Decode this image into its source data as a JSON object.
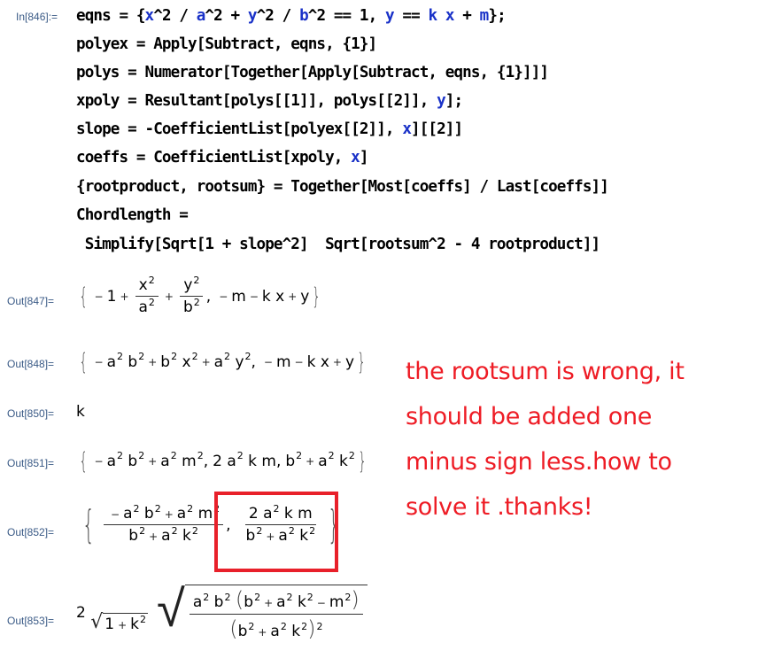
{
  "input": {
    "label": "In[846]:=",
    "lines": [
      {
        "parts": [
          {
            "t": "eqns = {"
          },
          {
            "t": "x",
            "v": 1
          },
          {
            "t": "^2 / "
          },
          {
            "t": "a",
            "v": 1
          },
          {
            "t": "^2 + "
          },
          {
            "t": "y",
            "v": 1
          },
          {
            "t": "^2 / "
          },
          {
            "t": "b",
            "v": 1
          },
          {
            "t": "^2 == 1, "
          },
          {
            "t": "y",
            "v": 1
          },
          {
            "t": " == "
          },
          {
            "t": "k",
            "v": 1
          },
          {
            "t": " "
          },
          {
            "t": "x",
            "v": 1
          },
          {
            "t": " + "
          },
          {
            "t": "m",
            "v": 1
          },
          {
            "t": "};"
          }
        ]
      },
      {
        "parts": [
          {
            "t": "polyex = Apply[Subtract, eqns, {1}]"
          }
        ]
      },
      {
        "parts": [
          {
            "t": "polys = Numerator[Together[Apply[Subtract, eqns, {1}]]]"
          }
        ]
      },
      {
        "parts": [
          {
            "t": "xpoly = Resultant[polys[[1]], polys[[2]], "
          },
          {
            "t": "y",
            "v": 1
          },
          {
            "t": "];"
          }
        ]
      },
      {
        "parts": [
          {
            "t": "slope = -CoefficientList[polyex[[2]], "
          },
          {
            "t": "x",
            "v": 1
          },
          {
            "t": "][[2]]"
          }
        ]
      },
      {
        "parts": [
          {
            "t": "coeffs = CoefficientList[xpoly, "
          },
          {
            "t": "x",
            "v": 1
          },
          {
            "t": "]"
          }
        ]
      },
      {
        "parts": [
          {
            "t": "{rootproduct, rootsum} = Together[Most[coeffs] / Last[coeffs]]"
          }
        ]
      },
      {
        "parts": [
          {
            "t": "Chordlength ="
          }
        ]
      },
      {
        "parts": [
          {
            "t": " Simplify[Sqrt[1 + slope^2]  Sqrt[rootsum^2 - 4 rootproduct]]"
          }
        ]
      }
    ]
  },
  "outputs": {
    "o847": {
      "label": "Out[847]=",
      "text": "{-1 + x²/a² + y²/b², -m - k x + y}"
    },
    "o848": {
      "label": "Out[848]=",
      "text": "{-a² b² + b² x² + a² y², -m - k x + y}"
    },
    "o850": {
      "label": "Out[850]=",
      "text": "k"
    },
    "o851": {
      "label": "Out[851]=",
      "text": "{-a² b² + a² m², 2 a² k m, b² + a² k²}"
    },
    "o852": {
      "label": "Out[852]=",
      "text": "{(-a² b² + a² m²)/(b² + a² k²), (2 a² k m)/(b² + a² k²)}"
    },
    "o853": {
      "label": "Out[853]=",
      "text": "2 √(1 + k²) √(a² b² (b² + a² k² - m²)/(b² + a² k²)²)"
    }
  },
  "annotation": {
    "text": "the rootsum is wrong, it\nshould be added one\nminus sign less.how to\nsolve it .thanks!",
    "color": "#ee1c25"
  }
}
